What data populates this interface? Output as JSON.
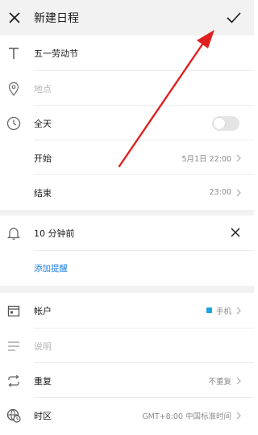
{
  "header": {
    "title": "新建日程"
  },
  "event": {
    "title_value": "五一劳动节",
    "location_placeholder": "地点",
    "allday_label": "全天",
    "start_label": "开始",
    "start_value": "5月1日 22:00",
    "end_label": "结束",
    "end_value": "23:00"
  },
  "reminder": {
    "value": "10 分钟前",
    "add_label": "添加提醒"
  },
  "account": {
    "label": "帐户",
    "value": "手机",
    "color": "#1aa3e8"
  },
  "description": {
    "placeholder": "说明"
  },
  "repeat": {
    "label": "重复",
    "value": "不重复"
  },
  "timezone": {
    "label": "时区",
    "value": "GMT+8:00 中国标准时间"
  },
  "annotation": {
    "color": "#e02020"
  },
  "icons": [
    "close-icon",
    "checkmark-icon",
    "text-icon",
    "location-pin-icon",
    "clock-icon",
    "bell-icon",
    "calendar-icon",
    "description-lines-icon",
    "repeat-icon",
    "globe-clock-icon",
    "chevron-right-icon"
  ]
}
